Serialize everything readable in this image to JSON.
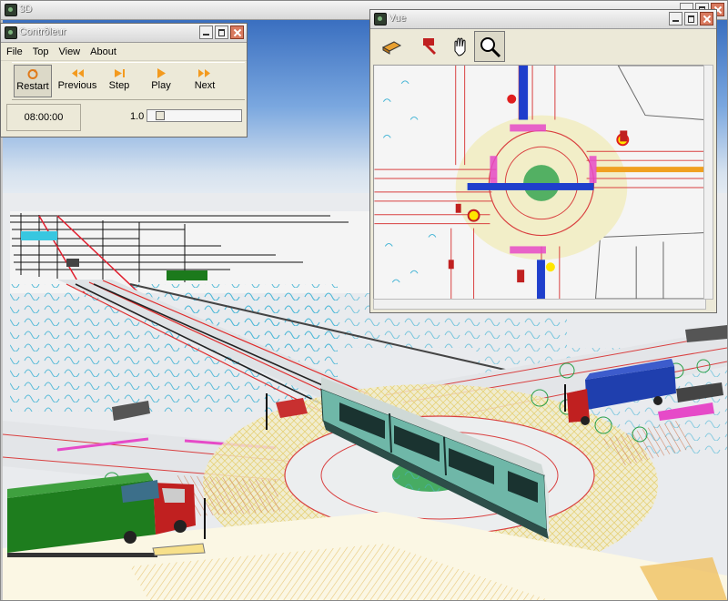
{
  "main_window": {
    "title": "3D"
  },
  "controleur": {
    "title": "Contrôleur",
    "menu": [
      "File",
      "Top",
      "View",
      "About"
    ],
    "buttons": {
      "restart": "Restart",
      "previous": "Previous",
      "step": "Step",
      "play": "Play",
      "next": "Next"
    },
    "time": "08:00:00",
    "speed_label": "1.0",
    "speed_value": 0.1
  },
  "vue": {
    "title": "Vue",
    "tools": [
      "layer-icon",
      "pointer-icon",
      "hand-icon",
      "zoom-icon"
    ]
  },
  "colors": {
    "tram_body": "#6fb7a8",
    "truck_green": "#1e7d1e",
    "truck_blue": "#1f3fae",
    "truck_cab_red": "#c02020",
    "road_line_red": "#d23c3c",
    "crosswalk_yellow": "#f0e68c",
    "grass_green": "#2aa04a",
    "sky_blue": "#5c8fd1"
  }
}
